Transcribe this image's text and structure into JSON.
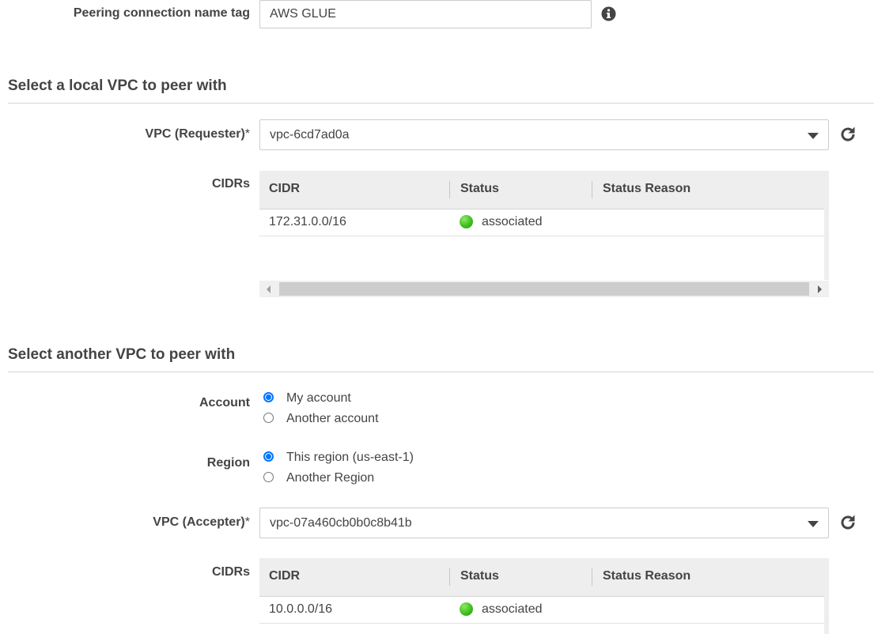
{
  "name_tag": {
    "label": "Peering connection name tag",
    "value": "AWS GLUE"
  },
  "local_section": {
    "title": "Select a local VPC to peer with",
    "vpc_label": "VPC (Requester)",
    "required_mark": "*",
    "vpc_value": "vpc-6cd7ad0a",
    "cidrs_label": "CIDRs",
    "columns": [
      "CIDR",
      "Status",
      "Status Reason"
    ],
    "rows": [
      {
        "cidr": "172.31.0.0/16",
        "status": "associated",
        "status_color": "#3fbf1c",
        "reason": ""
      }
    ]
  },
  "another_section": {
    "title": "Select another VPC to peer with",
    "account_label": "Account",
    "account_options": [
      "My account",
      "Another account"
    ],
    "account_selected": "My account",
    "region_label": "Region",
    "region_options": [
      "This region (us-east-1)",
      "Another Region"
    ],
    "region_selected": "This region (us-east-1)",
    "vpc_label": "VPC (Accepter)",
    "required_mark": "*",
    "vpc_value": "vpc-07a460cb0b0c8b41b",
    "cidrs_label": "CIDRs",
    "columns": [
      "CIDR",
      "Status",
      "Status Reason"
    ],
    "rows": [
      {
        "cidr": "10.0.0.0/16",
        "status": "associated",
        "status_color": "#3fbf1c",
        "reason": ""
      }
    ]
  },
  "icons": {
    "info": "info-icon",
    "refresh": "refresh-icon",
    "dropdown": "caret-down-icon",
    "status": "status-dot-icon"
  },
  "colors": {
    "radio_selected": "#0075ff",
    "status_ok": "#3fbf1c",
    "grid_header": "#eeeeee"
  }
}
